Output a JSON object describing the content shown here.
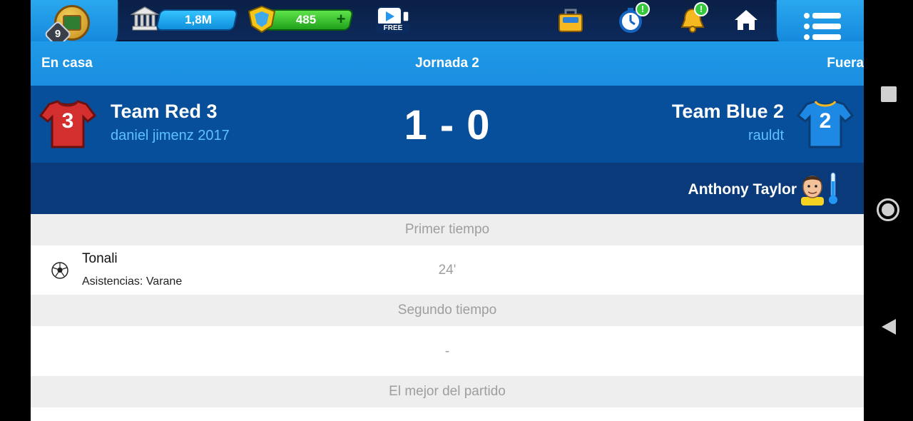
{
  "topbar": {
    "level": "9",
    "money": "1,8M",
    "tokens": "485",
    "free_label": "FREE",
    "alerts": [
      "!",
      "!"
    ]
  },
  "header": {
    "home_label": "En casa",
    "round_label": "Jornada 2",
    "away_label": "Fuera"
  },
  "match": {
    "home": {
      "team": "Team Red 3",
      "manager": "daniel jimenz 2017",
      "shirt_number": "3",
      "shirt_color": "#d32f2f"
    },
    "away": {
      "team": "Team Blue 2",
      "manager": "rauldt",
      "shirt_number": "2",
      "shirt_color": "#1e88e5"
    },
    "score": "1 - 0",
    "referee": "Anthony Taylor"
  },
  "events": {
    "first_half_label": "Primer tiempo",
    "first_half": [
      {
        "player": "Tonali",
        "assist": "Asistencias: Varane",
        "minute": "24'"
      }
    ],
    "second_half_label": "Segundo tiempo",
    "second_half_empty": "-",
    "mvp_label": "El mejor del partido"
  },
  "colors": {
    "accent": "#1b8ee0",
    "match_bg": "#084f9b",
    "ref_bg": "#0a3a7a",
    "topbar_bg": "#0d2a5c"
  }
}
